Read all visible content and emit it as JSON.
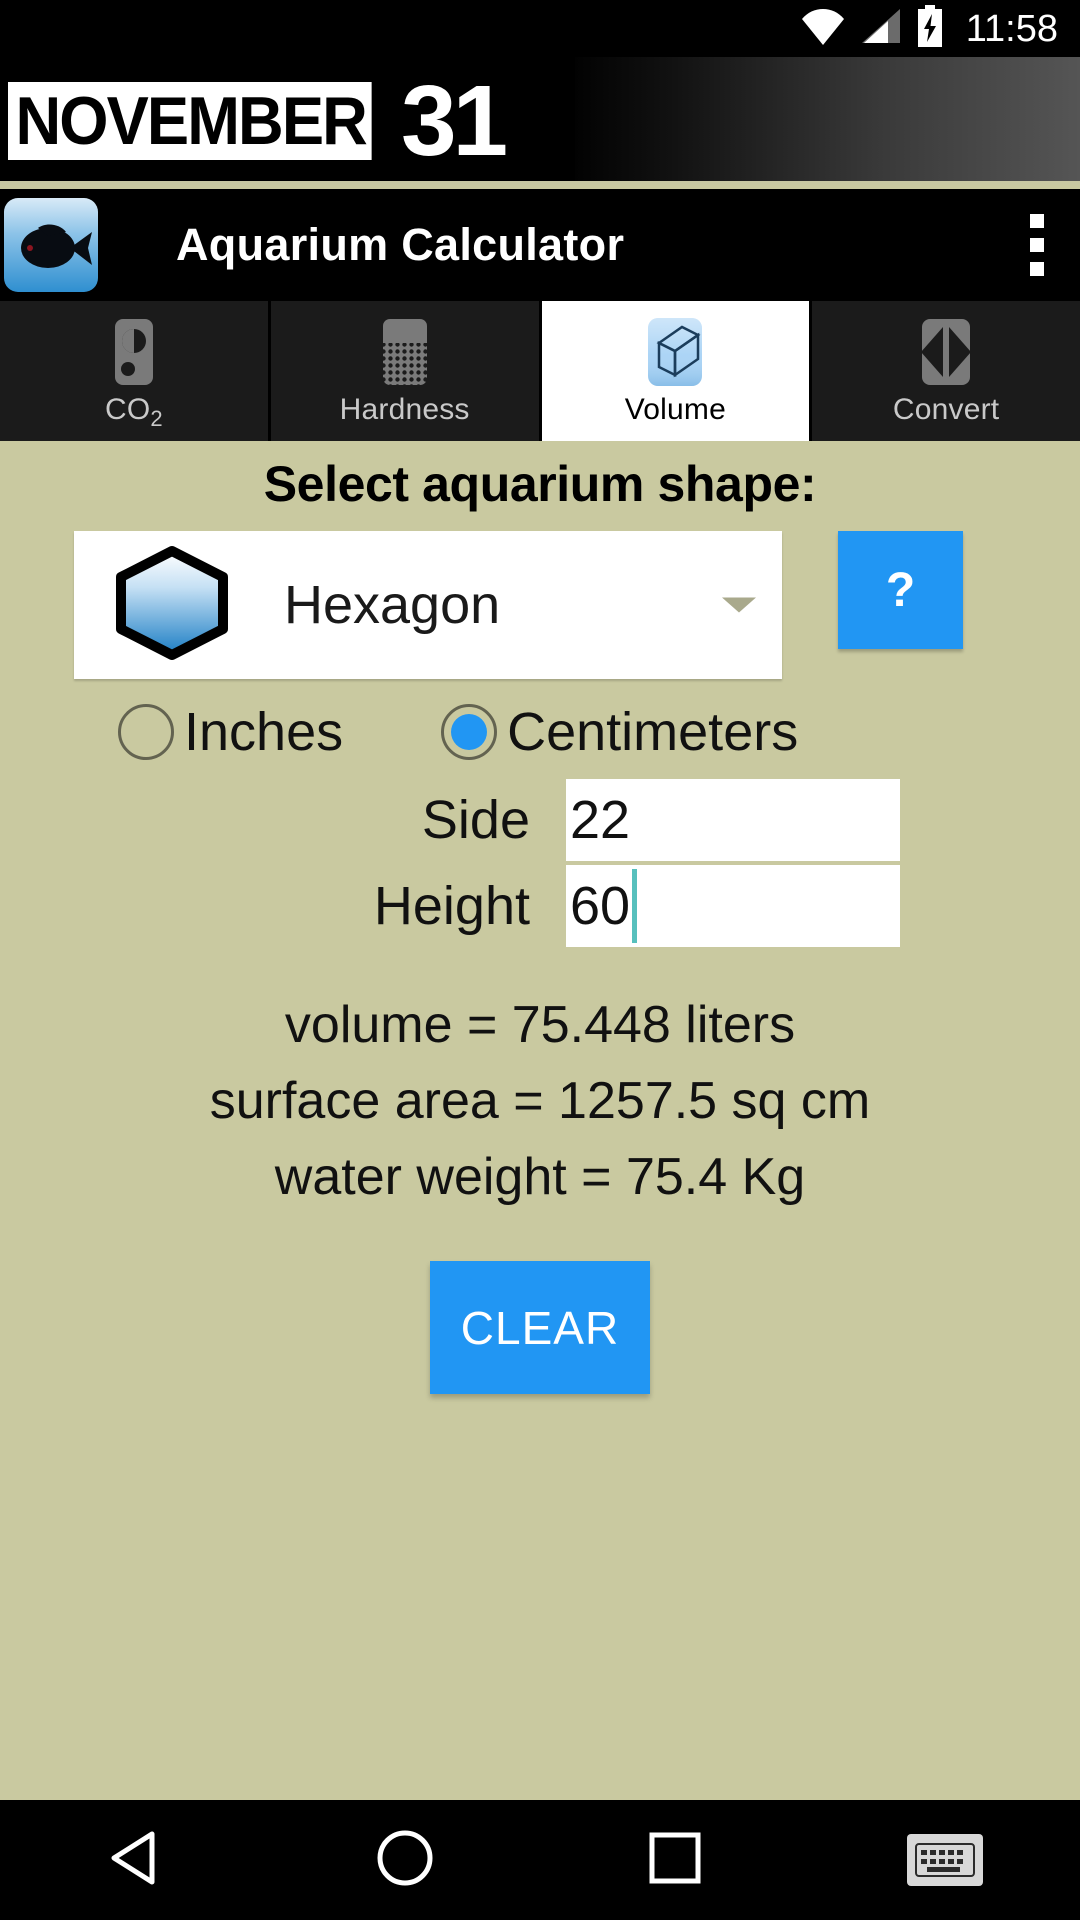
{
  "statusbar": {
    "time": "11:58",
    "icons": [
      "wifi-icon",
      "cellular-signal-icon",
      "battery-charging-icon"
    ]
  },
  "banner": {
    "word": "NOVEMBER",
    "number": "31"
  },
  "appbar": {
    "title": "Aquarium Calculator",
    "icon": "fish-app-icon",
    "overflow": "overflow-menu-icon"
  },
  "tabs": [
    {
      "label": "CO",
      "sub": "2",
      "icon": "co2-tank-icon",
      "selected": false
    },
    {
      "label": "Hardness",
      "sub": "",
      "icon": "water-hardness-icon",
      "selected": false
    },
    {
      "label": "Volume",
      "sub": "",
      "icon": "cube-volume-icon",
      "selected": true
    },
    {
      "label": "Convert",
      "sub": "",
      "icon": "convert-arrows-icon",
      "selected": false
    }
  ],
  "content": {
    "heading": "Select aquarium shape:",
    "shape_selector": {
      "selected_shape": "Hexagon",
      "shape_icon": "hexagon-icon",
      "caret": "chevron-down-icon"
    },
    "help_button": "?",
    "units": [
      {
        "label": "Inches",
        "selected": false
      },
      {
        "label": "Centimeters",
        "selected": true
      }
    ],
    "fields": [
      {
        "label": "Side",
        "value": "22",
        "focused": false
      },
      {
        "label": "Height",
        "value": "60",
        "focused": true
      }
    ],
    "results": [
      "volume = 75.448 liters",
      "surface area = 1257.5 sq cm",
      "water weight = 75.4 Kg"
    ],
    "clear_button": "CLEAR"
  },
  "navbar": {
    "back": "back-triangle-icon",
    "home": "home-circle-icon",
    "recents": "recents-square-icon",
    "keyboard": "keyboard-icon"
  },
  "colors": {
    "accent_blue": "#2196f3",
    "content_bg": "#c9c9a0",
    "bar_black": "#000000",
    "tab_bg": "#1b1b1b",
    "caret_teal": "#57c0bd"
  }
}
